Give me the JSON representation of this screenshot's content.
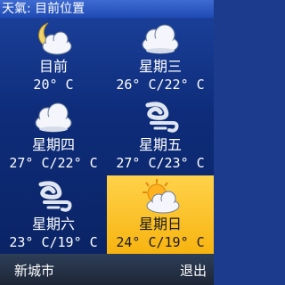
{
  "title": "天氣: 目前位置",
  "forecast": [
    {
      "day": "目前",
      "temp": "20° C",
      "icon": "moon-cloud-icon",
      "selected": false
    },
    {
      "day": "星期三",
      "temp": "26° C/22° C",
      "icon": "cloud-icon",
      "selected": false
    },
    {
      "day": "星期四",
      "temp": "27° C/22° C",
      "icon": "cloud-icon",
      "selected": false
    },
    {
      "day": "星期五",
      "temp": "27° C/23° C",
      "icon": "wind-icon",
      "selected": false
    },
    {
      "day": "星期六",
      "temp": "23° C/19° C",
      "icon": "wind-icon",
      "selected": false
    },
    {
      "day": "星期日",
      "temp": "24° C/19° C",
      "icon": "sun-cloud-icon",
      "selected": true
    }
  ],
  "softkeys": {
    "left": "新城市",
    "right": "退出"
  },
  "colors": {
    "background": "#1c3b8c",
    "selected": "#f7b410",
    "title_bar": "#2d5cc8"
  }
}
